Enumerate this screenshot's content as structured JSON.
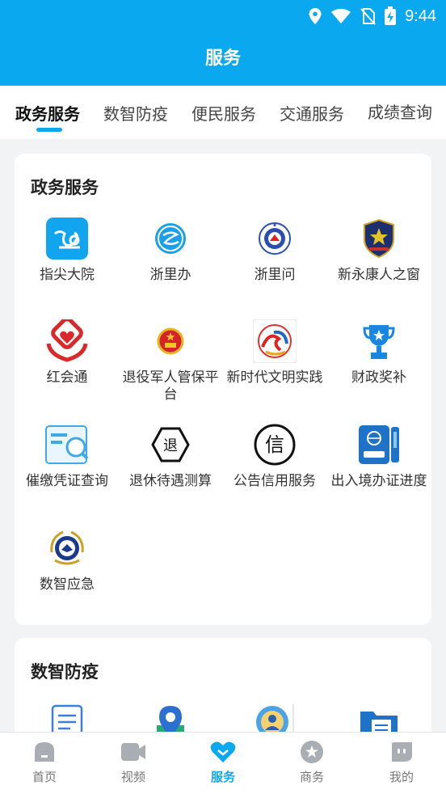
{
  "status_bar": {
    "time": "9:44"
  },
  "header": {
    "title": "服务"
  },
  "tabs": [
    {
      "label": "政务服务"
    },
    {
      "label": "数智防疫"
    },
    {
      "label": "便民服务"
    },
    {
      "label": "交通服务"
    },
    {
      "label": "成绩查询"
    }
  ],
  "sections": [
    {
      "title": "政务服务",
      "items": [
        {
          "label": "指尖大院",
          "icon": "fingertip-compound-icon"
        },
        {
          "label": "浙里办",
          "icon": "zheliban-icon"
        },
        {
          "label": "浙里问",
          "icon": "zheliwen-badge-icon"
        },
        {
          "label": "新永康人之窗",
          "icon": "police-badge-icon"
        },
        {
          "label": "红会通",
          "icon": "red-cross-hands-icon"
        },
        {
          "label": "退役军人管保平台",
          "icon": "national-emblem-icon"
        },
        {
          "label": "新时代文明实践",
          "icon": "civilization-logo-icon"
        },
        {
          "label": "财政奖补",
          "icon": "trophy-icon"
        },
        {
          "label": "催缴凭证查询",
          "icon": "voucher-search-icon"
        },
        {
          "label": "退休待遇测算",
          "icon": "retire-hexagon-icon"
        },
        {
          "label": "公告信用服务",
          "icon": "credit-circle-icon"
        },
        {
          "label": "出入境办证进度",
          "icon": "passport-icon"
        },
        {
          "label": "数智应急",
          "icon": "emergency-emblem-icon"
        }
      ]
    },
    {
      "title": "数智防疫",
      "items": [
        {
          "label": "",
          "icon": "document-form-icon"
        },
        {
          "label": "",
          "icon": "location-pin-icon"
        },
        {
          "label": "",
          "icon": "person-search-icon"
        },
        {
          "label": "",
          "icon": "folder-icon"
        }
      ]
    }
  ],
  "bottom_nav": [
    {
      "label": "首页",
      "icon": "home-icon"
    },
    {
      "label": "视频",
      "icon": "video-icon"
    },
    {
      "label": "服务",
      "icon": "heart-icon",
      "active": true
    },
    {
      "label": "商务",
      "icon": "star-icon"
    },
    {
      "label": "我的",
      "icon": "profile-icon"
    }
  ],
  "colors": {
    "accent": "#0aa8ee",
    "background": "#f2f3f5"
  }
}
